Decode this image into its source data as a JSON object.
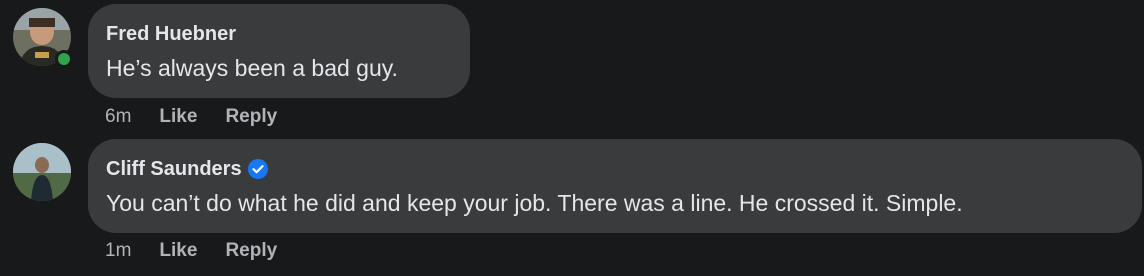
{
  "comments": [
    {
      "author": "Fred Huebner",
      "text": "He’s always been a bad guy.",
      "time": "6m",
      "like_label": "Like",
      "reply_label": "Reply",
      "verified": false,
      "online": true
    },
    {
      "author": "Cliff Saunders",
      "text": "You can’t do what he did and keep your job. There was a line. He crossed it. Simple.",
      "time": "1m",
      "like_label": "Like",
      "reply_label": "Reply",
      "verified": true,
      "online": false
    }
  ],
  "colors": {
    "background": "#18191a",
    "bubble": "#3a3b3c",
    "text": "#e4e6eb",
    "secondary": "#b0b3b8",
    "online": "#31a24c",
    "verified": "#1877f2"
  }
}
